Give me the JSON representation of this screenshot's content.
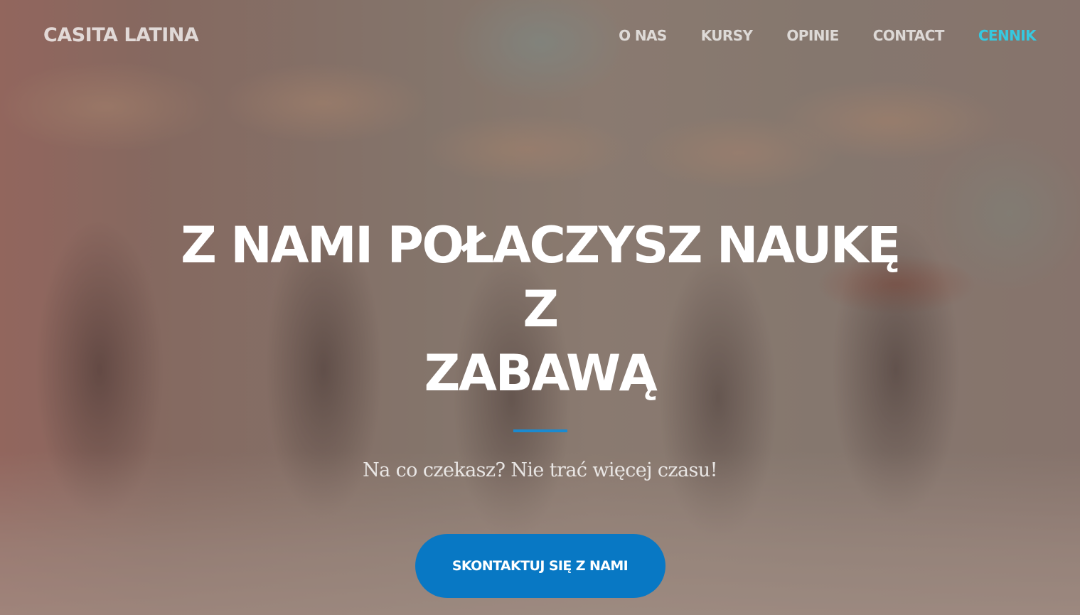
{
  "navbar": {
    "brand": "CASITA LATINA",
    "links": [
      {
        "label": "O NAS",
        "active": false
      },
      {
        "label": "KURSY",
        "active": false
      },
      {
        "label": "OPINIE",
        "active": false
      },
      {
        "label": "CONTACT",
        "active": false
      },
      {
        "label": "CENNIK",
        "active": true
      }
    ]
  },
  "masthead": {
    "headline_line1": "Z NAMI POŁACZYSZ NAUKĘ Z",
    "headline_line2": "ZABAWĄ",
    "subheadline": "Na co czekasz? Nie trać więcej czasu!",
    "cta_label": "SKONTAKTUJ SIĘ Z NAMI"
  },
  "colors": {
    "accent": "#0878c4",
    "active_link": "#36c8e0",
    "divider": "#1a8ad0"
  }
}
